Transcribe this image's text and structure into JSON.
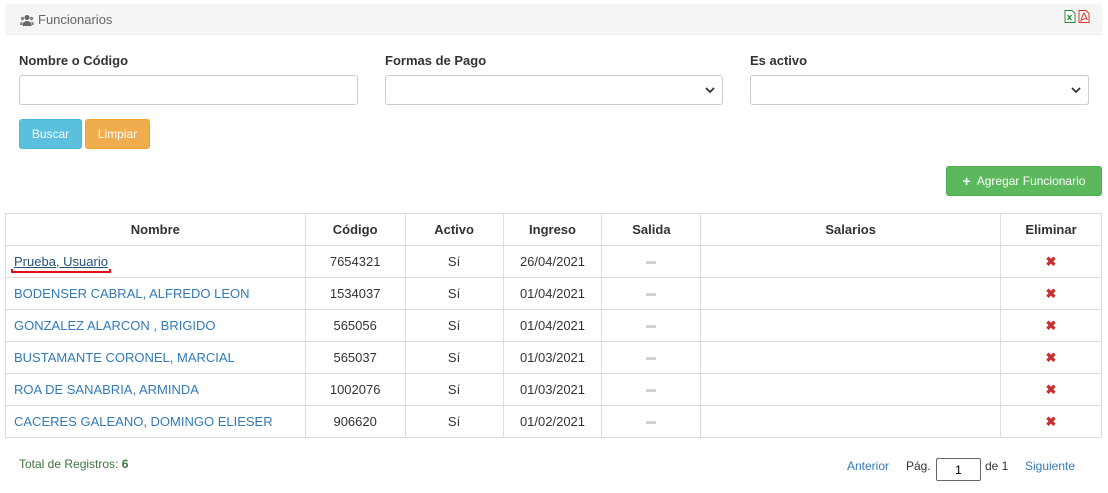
{
  "header": {
    "title": "Funcionarios",
    "icons": [
      "users-icon",
      "excel-export-icon",
      "pdf-export-icon"
    ]
  },
  "filters": {
    "name_label": "Nombre o Código",
    "name_value": "",
    "payment_label": "Formas de Pago",
    "payment_value": "",
    "active_label": "Es activo",
    "active_value": ""
  },
  "buttons": {
    "search": "Buscar",
    "clear": "Limpiar",
    "add": "Agregar Funcionario"
  },
  "table": {
    "columns": [
      "Nombre",
      "Código",
      "Activo",
      "Ingreso",
      "Salida",
      "Salarios",
      "Eliminar"
    ],
    "rows": [
      {
        "name": "Prueba, Usuario",
        "code": "7654321",
        "active": "Sí",
        "ingreso": "26/04/2021"
      },
      {
        "name": "BODENSER CABRAL, ALFREDO LEON",
        "code": "1534037",
        "active": "Sí",
        "ingreso": "01/04/2021"
      },
      {
        "name": "GONZALEZ ALARCON , BRIGIDO",
        "code": "565056",
        "active": "Sí",
        "ingreso": "01/04/2021"
      },
      {
        "name": "BUSTAMANTE CORONEL, MARCIAL",
        "code": "565037",
        "active": "Sí",
        "ingreso": "01/03/2021"
      },
      {
        "name": "ROA DE SANABRIA, ARMINDA",
        "code": "1002076",
        "active": "Sí",
        "ingreso": "01/03/2021"
      },
      {
        "name": "CACERES GALEANO, DOMINGO ELIESER",
        "code": "906620",
        "active": "Sí",
        "ingreso": "01/02/2021"
      }
    ]
  },
  "footer": {
    "total_label": "Total de Registros:",
    "total_count": "6",
    "prev": "Anterior",
    "page_label": "Pág.",
    "page_value": "1",
    "of_label": "de 1",
    "next": "Siguiente"
  },
  "colors": {
    "info": "#5bc0de",
    "warning": "#f0ad4e",
    "success": "#5cb85c",
    "link": "#337ab7",
    "danger": "#c9302c"
  }
}
